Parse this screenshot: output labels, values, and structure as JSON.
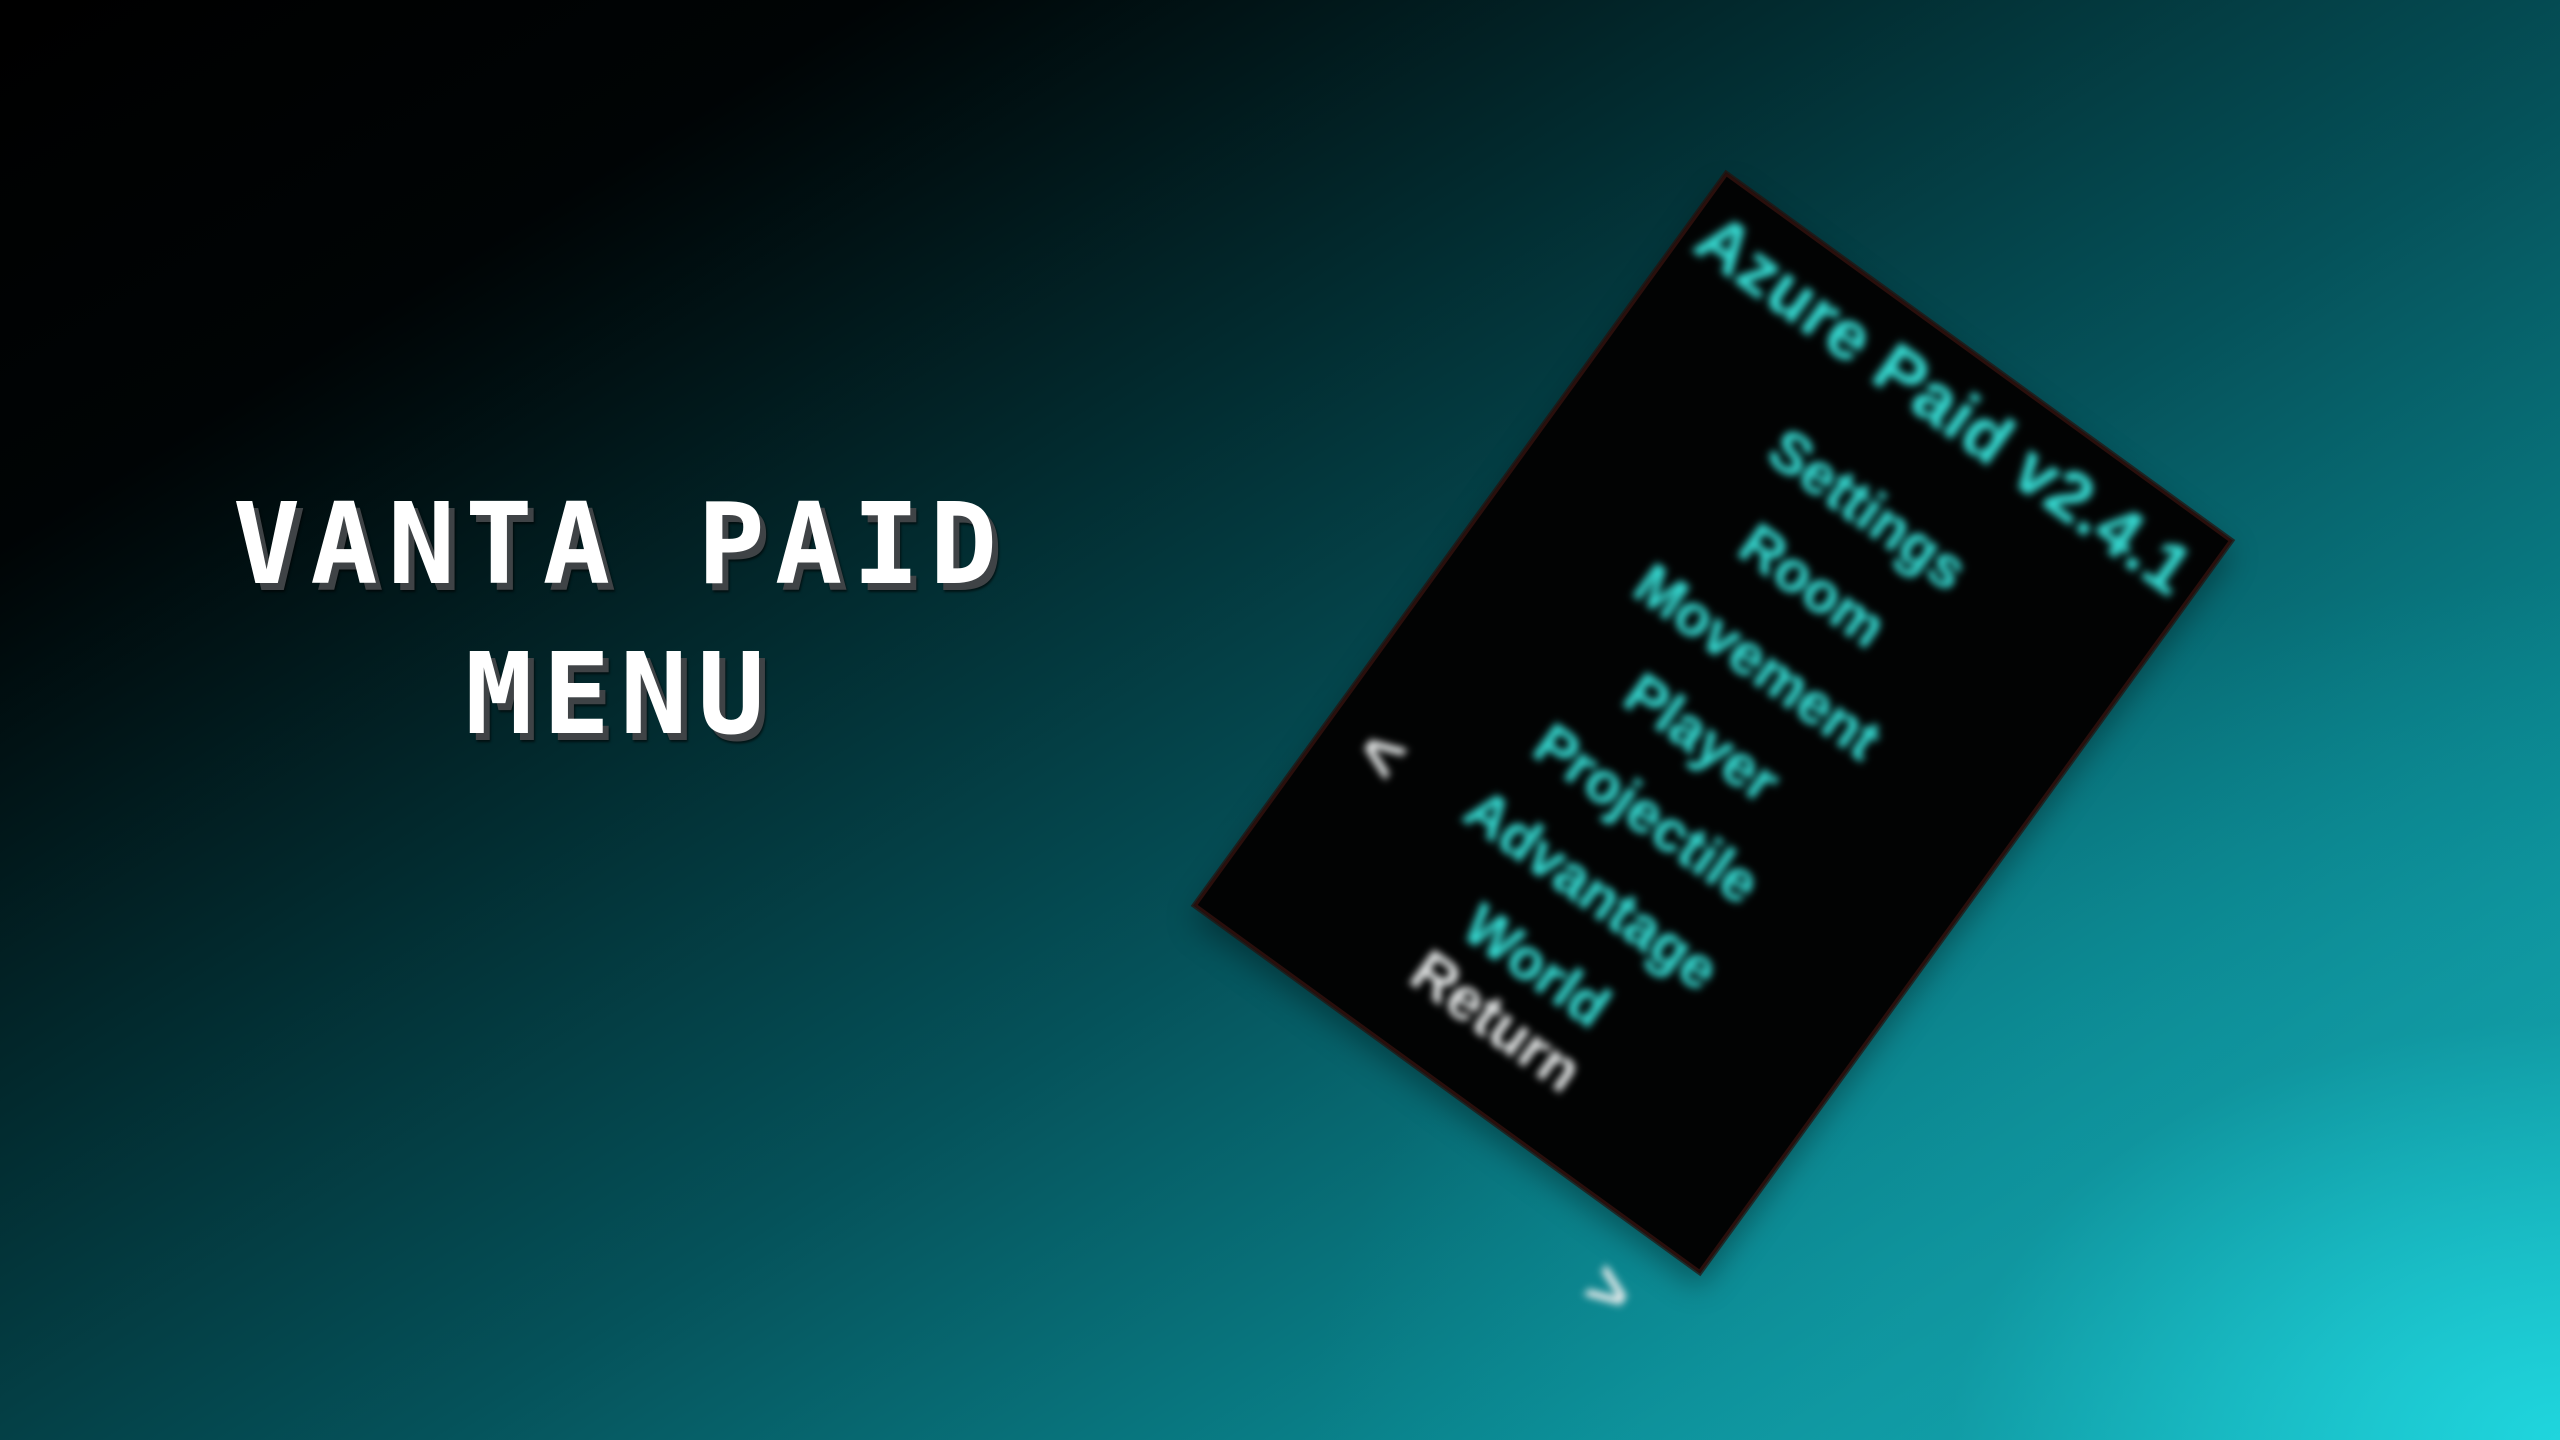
{
  "hero": {
    "line1": "VANTA PAID",
    "line2": "MENU"
  },
  "menu": {
    "title": "Azure Paid v2.4.1",
    "items": [
      {
        "label": "Settings"
      },
      {
        "label": "Room"
      },
      {
        "label": "Movement"
      },
      {
        "label": "Player"
      },
      {
        "label": "Projectile"
      },
      {
        "label": "Advantage"
      },
      {
        "label": "World"
      }
    ],
    "nav": {
      "prev": "<",
      "return": "Return",
      "next": ">"
    }
  },
  "colors": {
    "accent": "#35d8d0",
    "panel": "#020303",
    "nav_text": "#e9ecec",
    "title_text": "#ffffff"
  }
}
